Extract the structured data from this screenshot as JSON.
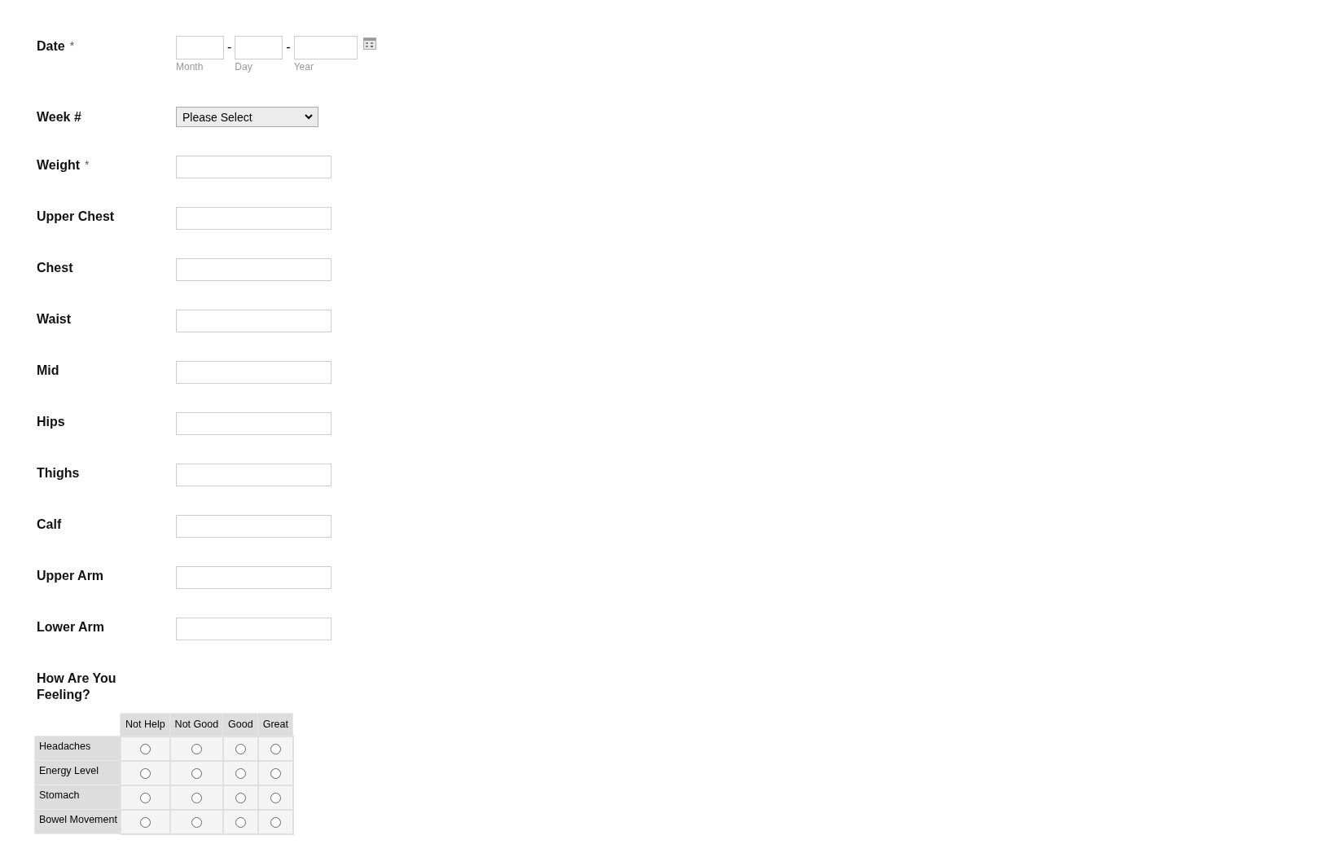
{
  "fields": [
    {
      "kind": "date",
      "label": "Date",
      "required_mark": "*",
      "parts": [
        {
          "sublabel": "Month"
        },
        {
          "sublabel": "Day"
        },
        {
          "sublabel": "Year"
        }
      ],
      "separator": "-"
    },
    {
      "kind": "select",
      "label": "Week #",
      "value": "Please Select"
    },
    {
      "kind": "text",
      "label": "Weight",
      "required_mark": "*"
    },
    {
      "kind": "text",
      "label": "Upper Chest"
    },
    {
      "kind": "text",
      "label": "Chest"
    },
    {
      "kind": "text",
      "label": "Waist"
    },
    {
      "kind": "text",
      "label": "Mid"
    },
    {
      "kind": "text",
      "label": "Hips"
    },
    {
      "kind": "text",
      "label": "Thighs"
    },
    {
      "kind": "text",
      "label": "Calf"
    },
    {
      "kind": "text",
      "label": "Upper Arm"
    },
    {
      "kind": "text",
      "label": "Lower Arm"
    },
    {
      "kind": "matrix",
      "label": "How Are You Feeling?",
      "columns": [
        "Not Help",
        "Not Good",
        "Good",
        "Great"
      ],
      "rows": [
        {
          "label": "Headaches",
          "cells": [
            {
              "selected": false
            },
            {
              "selected": false
            },
            {
              "selected": false
            },
            {
              "selected": false
            }
          ]
        },
        {
          "label": "Energy Level",
          "cells": [
            {
              "selected": false
            },
            {
              "selected": false
            },
            {
              "selected": false
            },
            {
              "selected": false
            }
          ]
        },
        {
          "label": "Stomach",
          "cells": [
            {
              "selected": false
            },
            {
              "selected": false
            },
            {
              "selected": false
            },
            {
              "selected": false
            }
          ]
        },
        {
          "label": "Bowel Movement",
          "cells": [
            {
              "selected": false
            },
            {
              "selected": false
            },
            {
              "selected": false
            },
            {
              "selected": false
            }
          ]
        }
      ]
    }
  ]
}
